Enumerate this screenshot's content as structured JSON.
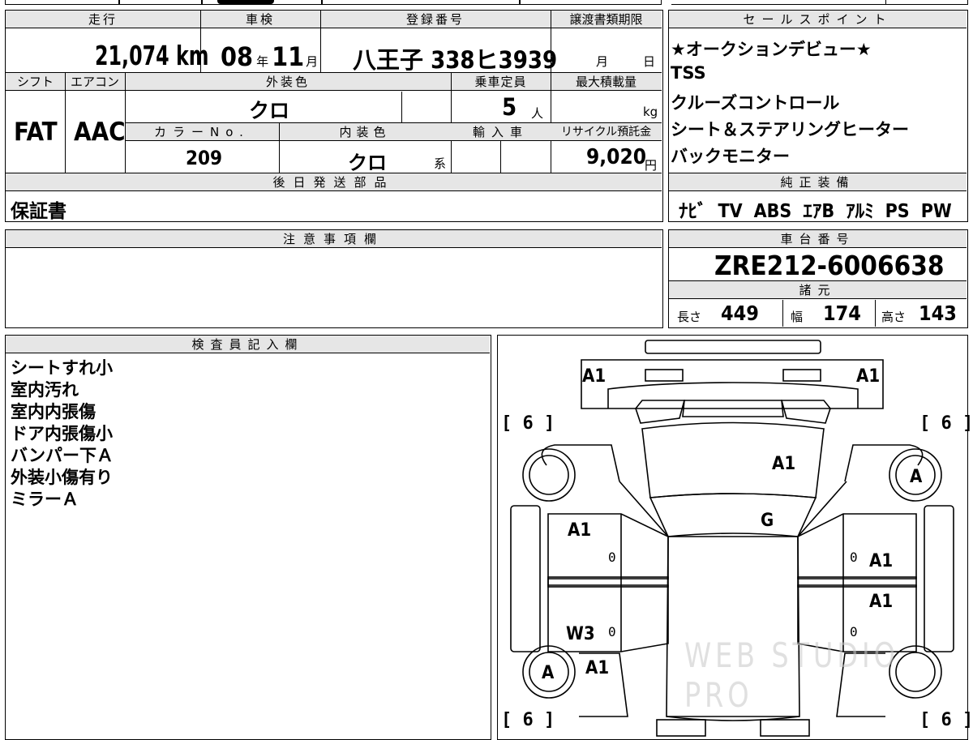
{
  "vehicle": {
    "mileage_label": "走行",
    "mileage": "21,074",
    "mileage_unit": "km",
    "inspection_label": "車検",
    "inspection_year": "08",
    "inspection_year_unit": "年",
    "inspection_month": "11",
    "inspection_month_unit": "月",
    "registration_label": "登録番号",
    "registration": "八王子 338ヒ3939",
    "transfer_label": "譲渡書類期限",
    "transfer_month_unit": "月",
    "transfer_day_unit": "日",
    "shift_label": "シフト",
    "shift": "FAT",
    "ac_label": "エアコン",
    "ac": "AAC",
    "exterior_color_label": "外装色",
    "exterior_color": "クロ",
    "capacity_label": "乗車定員",
    "capacity": "5",
    "capacity_unit": "人",
    "max_load_label": "最大積載量",
    "max_load_unit": "kg",
    "color_no_label": "カラーNo.",
    "color_no": "209",
    "interior_color_label": "内装色",
    "interior_color": "クロ",
    "interior_suffix": "系",
    "import_label": "輸入車",
    "recycle_label": "リサイクル預託金",
    "recycle_fee": "9,020",
    "recycle_unit": "円",
    "later_parts_label": "後日発送部品",
    "later_parts": "保証書"
  },
  "sales_points": {
    "label": "セールスポイント",
    "items": [
      "★オークションデビュー★",
      "TSS",
      "クルーズコントロール",
      "シート＆ステアリングヒーター",
      "バックモニター"
    ]
  },
  "equipment": {
    "label": "純正装備",
    "items": [
      "ﾅﾋﾞ",
      "TV",
      "ABS",
      "ｴｱB",
      "ｱﾙﾐ",
      "PS",
      "PW"
    ]
  },
  "notes": {
    "label": "注意事項欄"
  },
  "chassis": {
    "label": "車台番号",
    "number": "ZRE212-6006638",
    "spec_label": "諸元",
    "length_label": "長さ",
    "length": "449",
    "width_label": "幅",
    "width": "174",
    "height_label": "高さ",
    "height": "143"
  },
  "inspector": {
    "label": "検査員記入欄",
    "lines": [
      "シートすれ小",
      "室内汚れ",
      "室内内張傷",
      "ドア内張傷小",
      "バンパー下Ａ",
      "外装小傷有り",
      "ミラーＡ"
    ]
  },
  "diagram": {
    "tire_fl": "[ 6 ]",
    "tire_fr": "[ 6 ]",
    "tire_rl": "[ 6 ]",
    "tire_rr": "[ 6 ]",
    "headlight_left": "A1",
    "headlight_right": "A1",
    "hood": "A1",
    "windshield": "G",
    "front_left_door": "A1",
    "rear_left_door": "W3",
    "front_right_door": "A1",
    "rear_right_door": "A1",
    "front_right_wheel": "A",
    "rear_left_wheel": "A",
    "rear_left_fender": "A1",
    "zero_1": "0",
    "zero_2": "0",
    "zero_3": "0",
    "zero_4": "0",
    "watermark": "WEB STUDIO PRO"
  }
}
